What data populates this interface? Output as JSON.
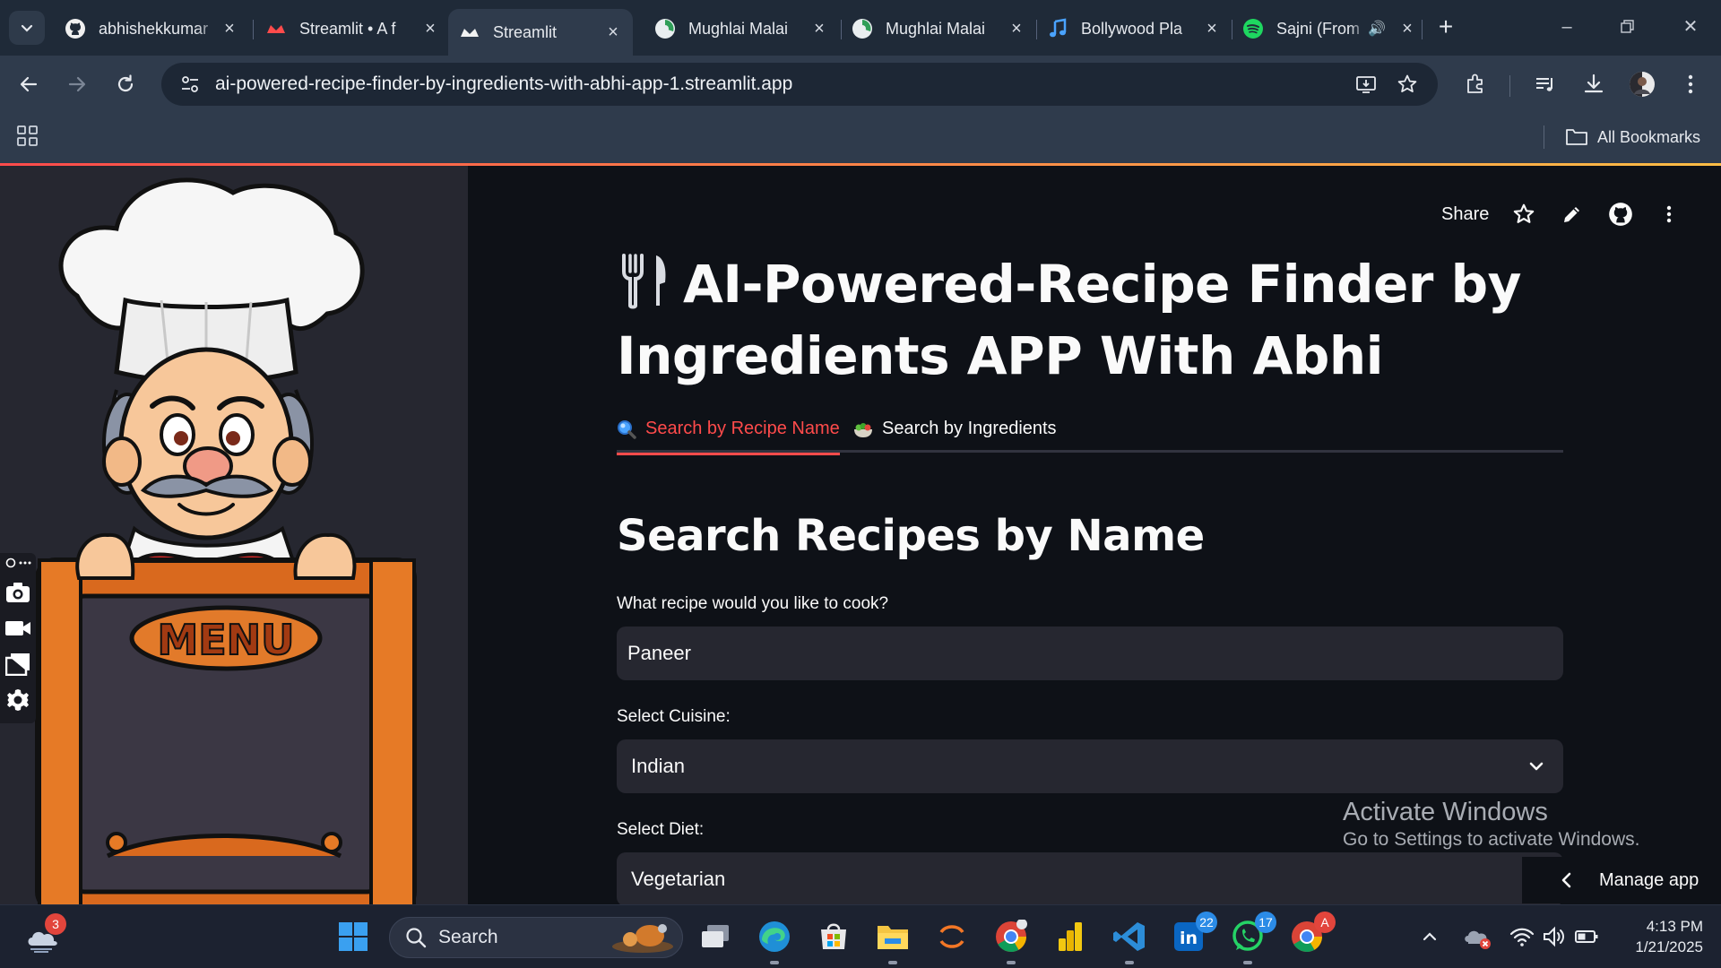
{
  "browser": {
    "tabs": [
      {
        "label": "abhishekkumar",
        "icon": "github-icon"
      },
      {
        "label": "Streamlit • A f",
        "icon": "streamlit-icon"
      },
      {
        "label": "Streamlit",
        "icon": "streamlit-icon",
        "active": true
      },
      {
        "label": "Mughlai Malai",
        "icon": "pie-chart-icon"
      },
      {
        "label": "Mughlai Malai",
        "icon": "pie-chart-icon"
      },
      {
        "label": "Bollywood Pla",
        "icon": "music-note-icon"
      },
      {
        "label": "Sajni (From",
        "icon": "spotify-icon",
        "audio": true
      }
    ],
    "url": "ai-powered-recipe-finder-by-ingredients-with-abhi-app-1.streamlit.app",
    "bookmarks_label": "All Bookmarks"
  },
  "app": {
    "header": {
      "share_label": "Share"
    },
    "title": "AI-Powered-Recipe Finder by Ingredients APP With Abhi",
    "tabs": [
      {
        "label": "Search by Recipe Name",
        "icon": "magnifier-icon",
        "active": true
      },
      {
        "label": "Search by Ingredients",
        "icon": "salad-bowl-icon"
      }
    ],
    "section_heading": "Search Recipes by Name",
    "form": {
      "recipe_label": "What recipe would you like to cook?",
      "recipe_value": "Paneer",
      "cuisine_label": "Select Cuisine:",
      "cuisine_value": "Indian",
      "diet_label": "Select Diet:",
      "diet_value": "Vegetarian"
    },
    "sidebar_image_text": "MENU",
    "manage_app_label": "Manage app"
  },
  "watermark": {
    "line1": "Activate Windows",
    "line2": "Go to Settings to activate Windows."
  },
  "taskbar": {
    "search_placeholder": "Search",
    "weather_badge": "3",
    "linkedin_badge": "22",
    "whatsapp_badge": "17",
    "chrome_profile_badge": "A",
    "time": "4:13 PM",
    "date": "1/21/2025"
  },
  "colors": {
    "accent": "#ff4b4b",
    "app_bg": "#0e1117",
    "sidebar_bg": "#262730",
    "browser_chrome": "#2f3b4c"
  }
}
